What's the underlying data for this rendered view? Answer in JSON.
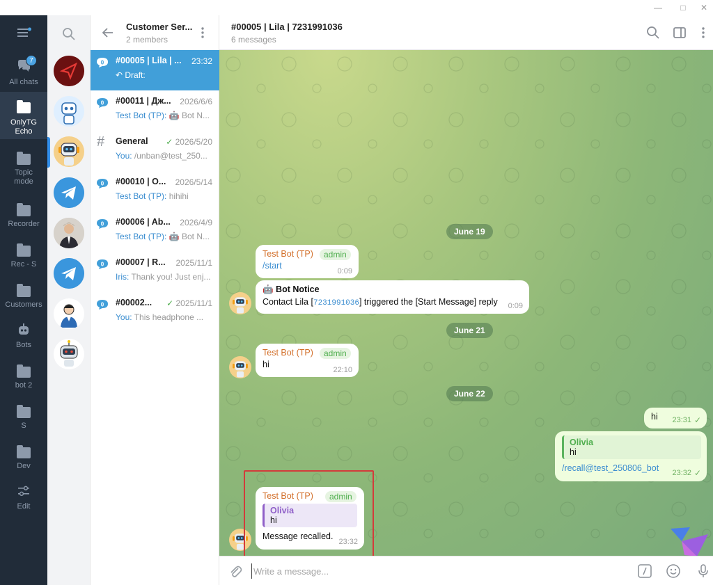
{
  "folders": [
    {
      "label": "All chats",
      "badge": "7"
    },
    {
      "label": "OnlyTG Echo"
    },
    {
      "label": "Topic mode"
    },
    {
      "label": "Recorder"
    },
    {
      "label": "Rec - S"
    },
    {
      "label": "Customers"
    },
    {
      "label": "Bots"
    },
    {
      "label": "bot 2"
    },
    {
      "label": "S"
    },
    {
      "label": "Dev"
    },
    {
      "label": "Edit"
    }
  ],
  "list": {
    "title": "Customer Ser...",
    "subtitle": "2 members",
    "rows": [
      {
        "title": "#00005 | Lila | ...",
        "time": "23:32",
        "who": "",
        "preview": "Draft:",
        "badge": "0"
      },
      {
        "title": "#00011 | Дж...",
        "time": "2026/6/6",
        "who": "Test Bot (TP):",
        "preview": " 🤖 Bot N...",
        "badge": "0"
      },
      {
        "title": "General",
        "time": "2026/5/20",
        "who": "You:",
        "preview": " /unban@test_250...",
        "badge": "#"
      },
      {
        "title": "#00010 | O...",
        "time": "2026/5/14",
        "who": "Test Bot (TP):",
        "preview": " hihihi",
        "badge": "0"
      },
      {
        "title": "#00006 | Ab...",
        "time": "2026/4/9",
        "who": "Test Bot (TP):",
        "preview": " 🤖 Bot N...",
        "badge": "0"
      },
      {
        "title": "#00007 | R...",
        "time": "2025/11/1",
        "who": "Iris:",
        "preview": " Thank you! Just enj...",
        "badge": "0"
      },
      {
        "title": "#00002...",
        "time": "2025/11/1",
        "who": "You:",
        "preview": " This headphone ...",
        "badge": "0"
      }
    ]
  },
  "chat": {
    "title": "#00005 | Lila | 7231991036",
    "subtitle": "6 messages",
    "dates": [
      "June 19",
      "June 21",
      "June 22"
    ],
    "m1": {
      "sender": "Test Bot (TP)",
      "tag": "admin",
      "text": "/start",
      "time": "0:09"
    },
    "m2": {
      "title": "Bot Notice",
      "pre": "Contact Lila [",
      "id": "7231991036",
      "post": "]  triggered the [Start Message] reply",
      "time": "0:09"
    },
    "m3": {
      "sender": "Test Bot (TP)",
      "tag": "admin",
      "text": "hi",
      "time": "22:10"
    },
    "m4": {
      "text": "hi",
      "time": "23:31"
    },
    "m5": {
      "quote_name": "Olivia",
      "quote_text": "hi",
      "text": "/recall@test_250806_bot",
      "time": "23:32"
    },
    "m6": {
      "sender": "Test Bot (TP)",
      "tag": "admin",
      "quote_name": "Olivia",
      "quote_text": "hi",
      "text": "Message recalled.",
      "time": "23:32"
    },
    "input_placeholder": "Write a message..."
  },
  "colors": {
    "accent": "#419fd9",
    "rail": "#212c39",
    "highlight": "#d33b3b"
  }
}
